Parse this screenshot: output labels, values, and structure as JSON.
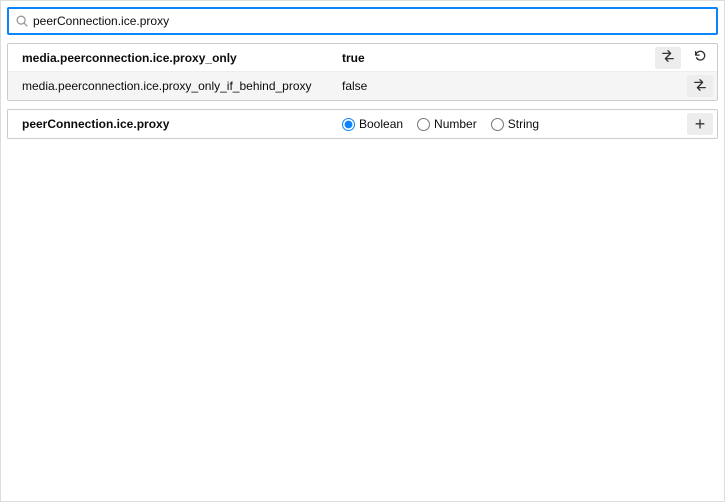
{
  "search": {
    "value": "peerConnection.ice.proxy"
  },
  "prefs": [
    {
      "name": "media.peerconnection.ice.proxy_only",
      "value": "true",
      "modified": true,
      "hasReset": true
    },
    {
      "name": "media.peerconnection.ice.proxy_only_if_behind_proxy",
      "value": "false",
      "modified": false,
      "hasReset": false
    }
  ],
  "add": {
    "name": "peerConnection.ice.proxy",
    "types": [
      {
        "label": "Boolean",
        "selected": true
      },
      {
        "label": "Number",
        "selected": false
      },
      {
        "label": "String",
        "selected": false
      }
    ]
  }
}
